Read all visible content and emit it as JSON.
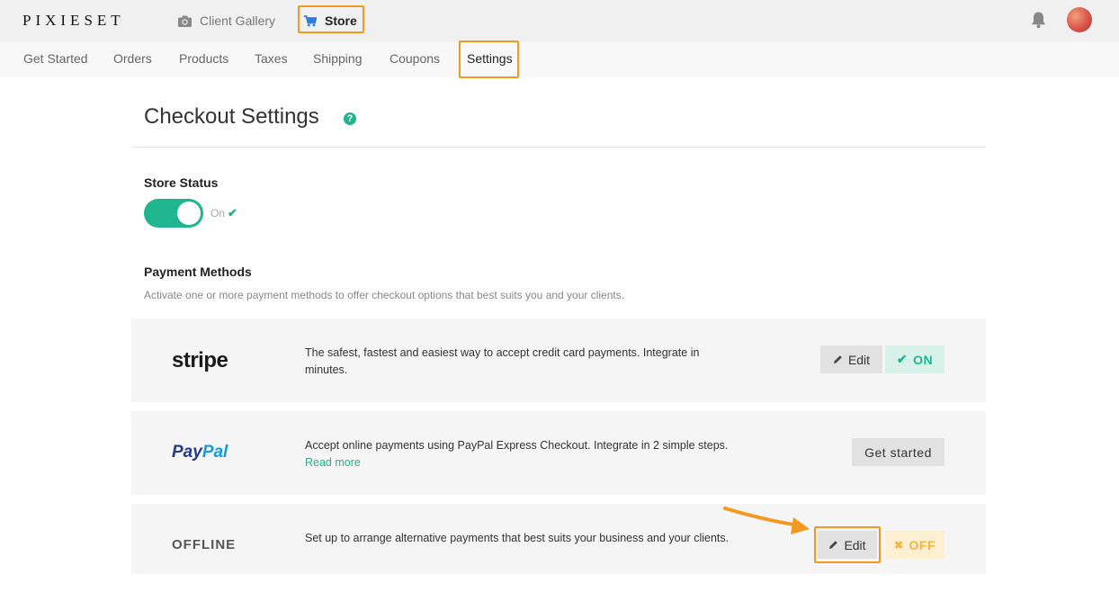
{
  "brand": {
    "logo": "PIXIESET"
  },
  "topnav": {
    "gallery_label": "Client Gallery",
    "store_label": "Store"
  },
  "subnav": [
    {
      "label": "Get Started"
    },
    {
      "label": "Orders"
    },
    {
      "label": "Products"
    },
    {
      "label": "Taxes"
    },
    {
      "label": "Shipping"
    },
    {
      "label": "Coupons"
    },
    {
      "label": "Settings",
      "active": true
    }
  ],
  "page": {
    "title": "Checkout Settings",
    "help_icon": "?"
  },
  "store_status": {
    "heading": "Store Status",
    "state": "On",
    "check": "✔"
  },
  "payment_methods": {
    "heading": "Payment Methods",
    "description": "Activate one or more payment methods to offer checkout options that best suits you and your clients.",
    "stripe": {
      "logo": "stripe",
      "line1": "The safest, fastest and easiest way to accept credit card payments. Integrate in",
      "line2": "minutes.",
      "edit_label": "Edit",
      "status_icon": "✔",
      "status_label": "ON"
    },
    "paypal": {
      "logo_pay": "Pay",
      "logo_pal": "Pal",
      "line1": "Accept online payments using PayPal Express Checkout. Integrate in 2 simple steps.",
      "read_more": "Read more",
      "button_label": "Get started"
    },
    "offline": {
      "logo": "OFFLINE",
      "line1": "Set up to arrange alternative payments that best suits your business and your clients.",
      "edit_label": "Edit",
      "status_icon": "✖",
      "status_label": "OFF"
    }
  },
  "colors": {
    "accent": "#1fb58e",
    "highlight": "#f19a1f",
    "off": "#f4b63e",
    "paypal_dark": "#253b80",
    "paypal_light": "#179bd7"
  },
  "icons": [
    "camera-icon",
    "cart-icon",
    "bell-icon",
    "help-icon",
    "pencil-icon",
    "check-icon",
    "x-icon"
  ]
}
